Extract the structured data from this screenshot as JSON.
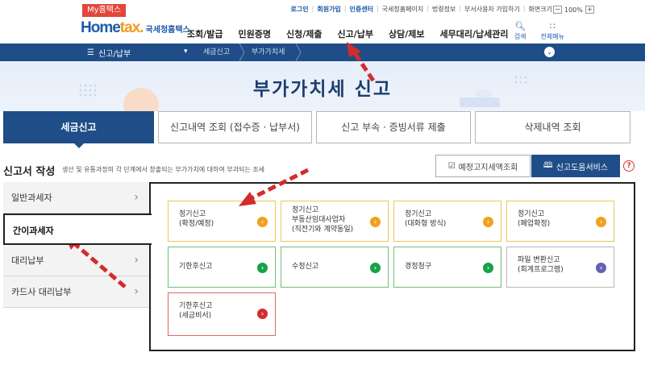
{
  "topbar": {
    "mybadge": "My홈택스",
    "links": [
      "로그인",
      "회원가입",
      "인증센터",
      "국세청홈페이지",
      "법령정보",
      "부서사용자 가입하기",
      "화면크기"
    ],
    "zoom_value": "100%",
    "zoom_minus": "−",
    "zoom_plus": "+"
  },
  "header": {
    "logo_home": "Home",
    "logo_tax": "tax.",
    "logo_sub": "국세청홈택스",
    "gnb": [
      "조회/발급",
      "민원증명",
      "신청/제출",
      "신고/납부",
      "상담/제보",
      "세무대리/납세관리"
    ],
    "search_label": "검색",
    "allmenu_label": "전체메뉴"
  },
  "lnb": {
    "menu_label": "신고/납부",
    "crumb1": "세금신고",
    "crumb2": "부가가치세"
  },
  "hero": {
    "title": "부가가치세  신고"
  },
  "tabs": [
    {
      "label": "세금신고",
      "active": true
    },
    {
      "label": "신고내역 조회 (접수증 · 납부서)",
      "active": false
    },
    {
      "label": "신고 부속 · 증빙서류 제출",
      "active": false
    },
    {
      "label": "삭제내역 조회",
      "active": false
    }
  ],
  "section": {
    "title": "신고서 작성",
    "desc": "생산 및 유통과정의 각 단계에서 창출되는 부가가치에 대하여 부과되는 조세",
    "btn_yejeong": "예정고지세액조회",
    "btn_help": "신고도움서비스",
    "help_mark": "?"
  },
  "sidenav": [
    {
      "label": "일반과세자",
      "active": false
    },
    {
      "label": "간이과세자",
      "active": true
    },
    {
      "label": "대리납부",
      "active": false
    },
    {
      "label": "카드사 대리납부",
      "active": false
    }
  ],
  "cards": [
    {
      "line1": "정기신고",
      "line2": "(확정/예정)",
      "line3": "",
      "color": "yellow"
    },
    {
      "line1": "정기신고",
      "line2": "부동산임대사업자",
      "line3": "(직전기와 계약동일)",
      "color": "yellow"
    },
    {
      "line1": "정기신고",
      "line2": "(대화형 방식)",
      "line3": "",
      "color": "yellow"
    },
    {
      "line1": "정기신고",
      "line2": "(폐업확정)",
      "line3": "",
      "color": "yellow"
    },
    {
      "line1": "기한후신고",
      "line2": "",
      "line3": "",
      "color": "green"
    },
    {
      "line1": "수정신고",
      "line2": "",
      "line3": "",
      "color": "green"
    },
    {
      "line1": "경정청구",
      "line2": "",
      "line3": "",
      "color": "green"
    },
    {
      "line1": "파일 변환신고",
      "line2": "(회계프로그램)",
      "line3": "",
      "color": "purple"
    },
    {
      "line1": "기한후신고",
      "line2": "(세금비서)",
      "line3": "",
      "color": "red"
    }
  ],
  "arrow_glyph": "›",
  "colors": {
    "nav_blue": "#1f4d87",
    "accent_red": "#d42b2b",
    "yellow": "#f2a11d",
    "green": "#16a24a",
    "purple": "#6460b4"
  }
}
